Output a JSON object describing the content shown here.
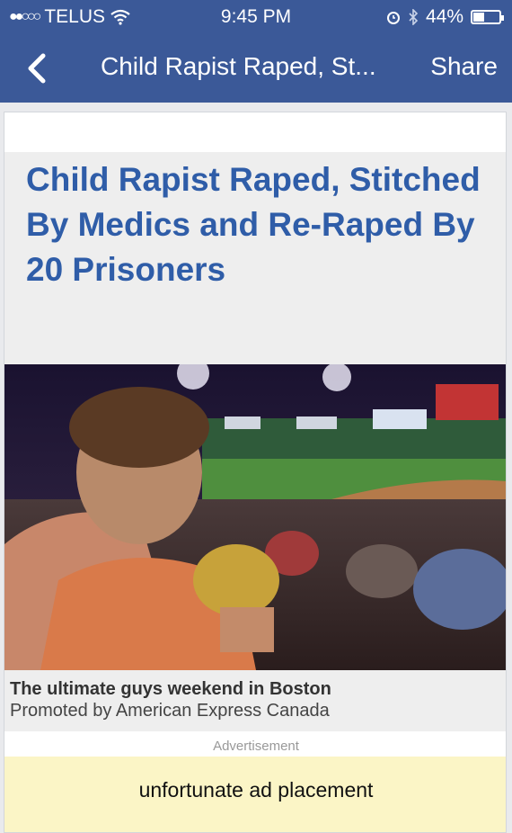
{
  "status_bar": {
    "carrier": "TELUS",
    "time": "9:45 PM",
    "battery_percent": "44%",
    "battery_level": 0.44
  },
  "nav": {
    "back_icon": "chevron-left-icon",
    "title": "Child Rapist Raped, St...",
    "share_label": "Share"
  },
  "article": {
    "headline": "Child Rapist Raped, Stitched By Medics and Re-Raped By 20 Prisoners"
  },
  "promo": {
    "title": "The ultimate guys weekend in Boston",
    "sponsor": "Promoted by American Express Canada"
  },
  "ad": {
    "label": "Advertisement",
    "annotation": "unfortunate ad placement"
  },
  "colors": {
    "facebook_blue": "#3b5998",
    "headline_blue": "#2f5da8",
    "ad_yellow": "#fbf5c6"
  }
}
